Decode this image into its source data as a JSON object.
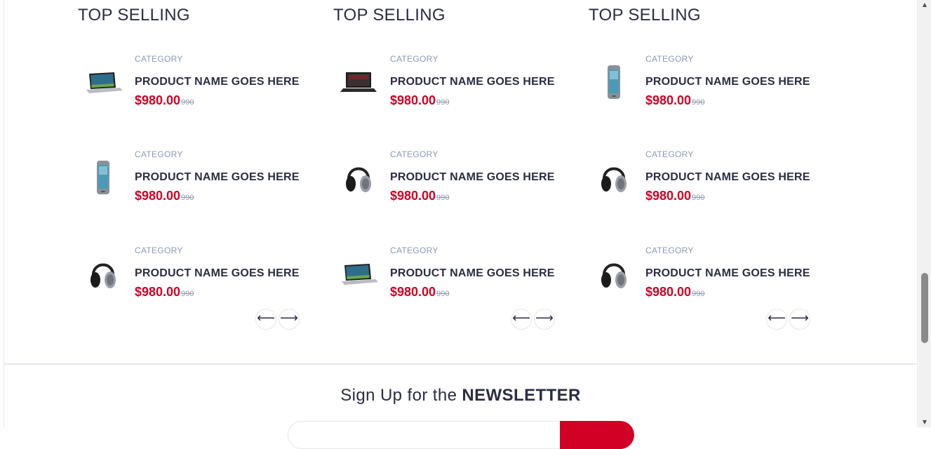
{
  "columns": [
    {
      "title": "TOP SELLING",
      "products": [
        {
          "category": "CATEGORY",
          "name": "PRODUCT NAME GOES HERE",
          "price": "$980.00",
          "old_price": "990",
          "image": "laptop-image"
        },
        {
          "category": "CATEGORY",
          "name": "PRODUCT NAME GOES HERE",
          "price": "$980.00",
          "old_price": "990",
          "image": "phone-image"
        },
        {
          "category": "CATEGORY",
          "name": "PRODUCT NAME GOES HERE",
          "price": "$980.00",
          "old_price": "990",
          "image": "headphones-image"
        }
      ],
      "nav": {
        "prev": "⟵",
        "next": "⟶"
      }
    },
    {
      "title": "TOP SELLING",
      "products": [
        {
          "category": "CATEGORY",
          "name": "PRODUCT NAME GOES HERE",
          "price": "$980.00",
          "old_price": "990",
          "image": "laptop-image"
        },
        {
          "category": "CATEGORY",
          "name": "PRODUCT NAME GOES HERE",
          "price": "$980.00",
          "old_price": "990",
          "image": "headphones-image"
        },
        {
          "category": "CATEGORY",
          "name": "PRODUCT NAME GOES HERE",
          "price": "$980.00",
          "old_price": "990",
          "image": "laptop-image"
        }
      ],
      "nav": {
        "prev": "⟵",
        "next": "⟶"
      }
    },
    {
      "title": "TOP SELLING",
      "products": [
        {
          "category": "CATEGORY",
          "name": "PRODUCT NAME GOES HERE",
          "price": "$980.00",
          "old_price": "990",
          "image": "phone-image"
        },
        {
          "category": "CATEGORY",
          "name": "PRODUCT NAME GOES HERE",
          "price": "$980.00",
          "old_price": "990",
          "image": "headphones-image"
        },
        {
          "category": "CATEGORY",
          "name": "PRODUCT NAME GOES HERE",
          "price": "$980.00",
          "old_price": "990",
          "image": "headphones-image"
        }
      ],
      "nav": {
        "prev": "⟵",
        "next": "⟶"
      }
    }
  ],
  "newsletter": {
    "title_prefix": "Sign Up for the ",
    "title_emphasis": "NEWSLETTER"
  },
  "colors": {
    "accent": "#d10024",
    "text": "#2b2d42",
    "muted": "#8d99ae",
    "border": "#e4e7ed"
  }
}
